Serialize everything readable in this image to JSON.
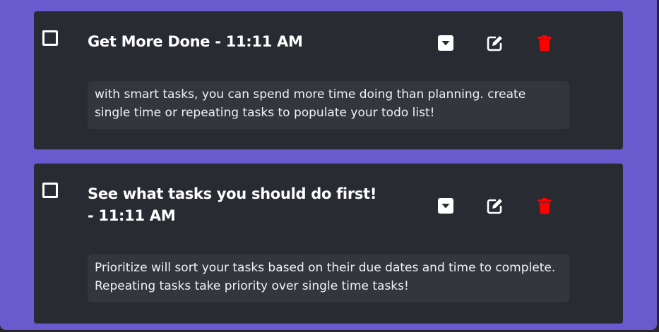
{
  "tasks": [
    {
      "title": "Get More Done - 11:11 AM",
      "description": "with smart tasks, you can spend more time doing than planning. create single time or repeating tasks to populate your todo list!"
    },
    {
      "title": "See what tasks you should do first!\n- 11:11 AM",
      "description": "Prioritize will sort your tasks based on their due dates and time to complete. Repeating tasks take priority over single time tasks!"
    }
  ],
  "icons": {
    "toggle": "caret-down-square-icon",
    "edit": "edit-icon",
    "delete": "trash-icon"
  },
  "colors": {
    "frame": "#6a5acd",
    "card": "#282b31",
    "description_bg": "#33363d",
    "delete_icon": "#ff0000",
    "text": "#ffffff"
  }
}
